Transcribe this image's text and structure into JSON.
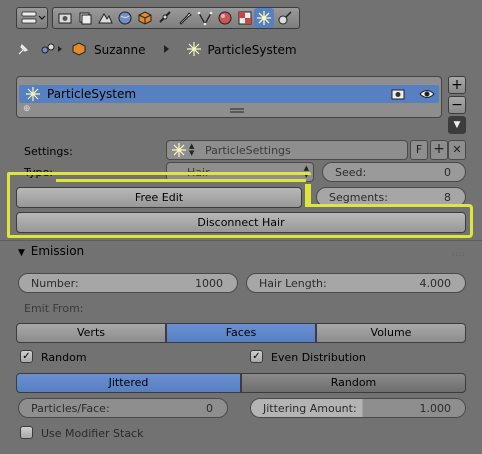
{
  "breadcrumb": {
    "object": "Suzanne",
    "system": "ParticleSystem"
  },
  "list": {
    "item": "ParticleSystem",
    "add": "+",
    "remove": "−"
  },
  "settings": {
    "label": "Settings:",
    "value": "ParticleSettings",
    "fake_user": "F",
    "add": "+",
    "close": "✕"
  },
  "type": {
    "label": "Type:",
    "value": "Hair"
  },
  "seed": {
    "label": "Seed:",
    "value": "0"
  },
  "segments": {
    "label": "Segments:",
    "value": "8"
  },
  "buttons": {
    "free_edit": "Free Edit",
    "disconnect": "Disconnect Hair"
  },
  "emission": {
    "title": "Emission",
    "number_label": "Number:",
    "number_value": "1000",
    "hair_length_label": "Hair Length:",
    "hair_length_value": "4.000",
    "emit_from": "Emit From:",
    "emit_options": [
      "Verts",
      "Faces",
      "Volume"
    ],
    "emit_selected": "Faces",
    "random": "Random",
    "even_distribution": "Even Distribution",
    "dist_options": [
      "Jittered",
      "Random"
    ],
    "dist_selected": "Jittered",
    "particles_face_label": "Particles/Face:",
    "particles_face_value": "0",
    "jittering_label": "Jittering Amount:",
    "jittering_value": "1.000",
    "use_modifier_stack": "Use Modifier Stack"
  },
  "colors": {
    "accent": "#5680c2",
    "highlight": "#dfe53a",
    "panel": "#727272"
  }
}
